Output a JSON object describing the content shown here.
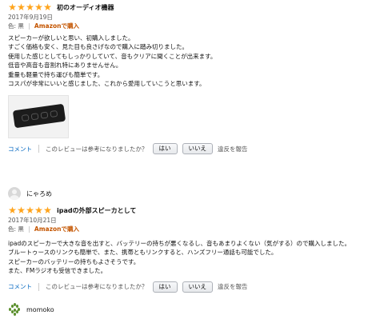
{
  "colors": {
    "star": "#ffa41c",
    "verified": "#c45500",
    "link": "#0066c0"
  },
  "review1": {
    "stars": 5,
    "title": "初のオーディオ機器",
    "date": "2017年9月19日",
    "color_label": "色: 黒",
    "badge": "Amazonで購入",
    "lines": [
      "スピーカーが欲しいと思い、初購入しました。",
      "すごく価格も安く、見た目も良さげなので購入に踏み切りました。",
      "使用した感じとしてもしっかりしていて、音もクリアに聞くことが出来ます。",
      "低音や高音も音割れ特にありませんせん。",
      "重量も軽量で持ち運びも簡単です。",
      "コスパが非常にいいと感じました、これから愛用していこうと思います。"
    ],
    "image_icon": "speaker-photo",
    "comment": "コメント",
    "question": "このレビューは参考になりましたか？",
    "yes": "はい",
    "no": "いいえ",
    "report": "違反を報告"
  },
  "user2": {
    "name": "にゃろめ",
    "avatar_icon": "default-user-icon"
  },
  "review2": {
    "stars": 5,
    "title": "ipadの外部スピーカとして",
    "date": "2017年10月21日",
    "color_label": "色: 黒",
    "badge": "Amazonで購入",
    "lines": [
      "ipadのスピーカーで大きな音を出すと、バッテリーの持ちが悪くなるし、音もあまりよくない（気がする）ので購入しました。",
      "ブルートゥースのリンクも簡単で、また、携帯ともリンクすると、ハンズフリー通話も可能でした。",
      "スピーカーのバッテリーの持ちもよさそうです。",
      "また、FMラジオも受信できました。"
    ],
    "comment": "コメント",
    "question": "このレビューは参考になりましたか？",
    "yes": "はい",
    "no": "いいえ",
    "report": "違反を報告"
  },
  "user3": {
    "name": "momoko",
    "avatar_icon": "leaf-pattern-avatar-icon"
  }
}
